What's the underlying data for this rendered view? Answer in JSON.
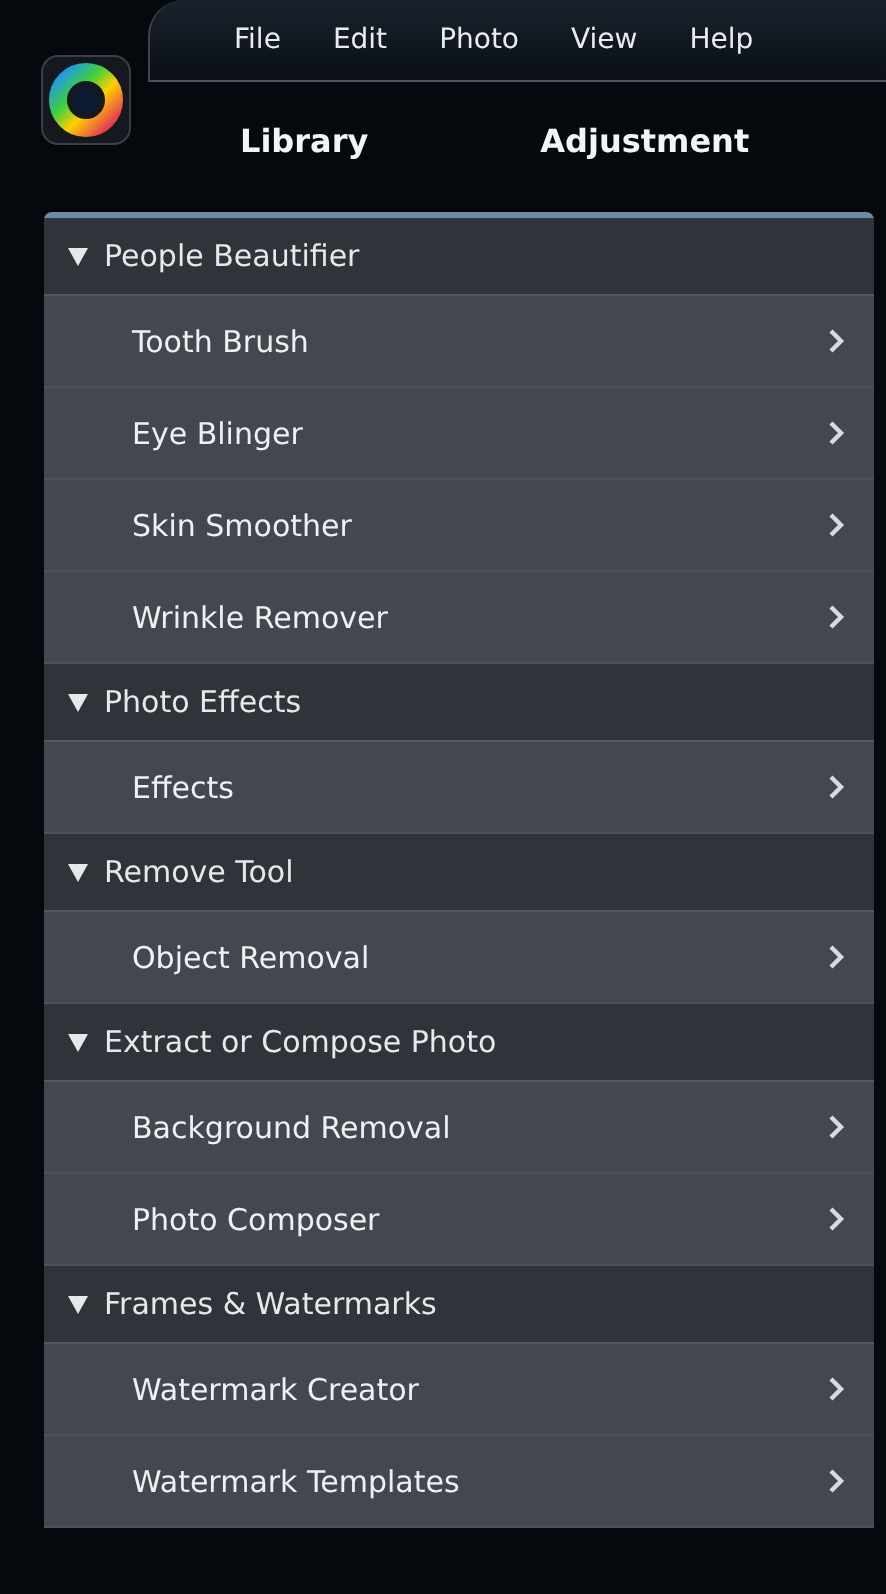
{
  "menu_bar": {
    "items": [
      "File",
      "Edit",
      "Photo",
      "View",
      "Help"
    ]
  },
  "tabs": [
    {
      "label": "Library"
    },
    {
      "label": "Adjustment"
    }
  ],
  "sections": [
    {
      "title": "People Beautifier",
      "expanded": true,
      "items": [
        "Tooth Brush",
        "Eye Blinger",
        "Skin Smoother",
        "Wrinkle Remover"
      ]
    },
    {
      "title": "Photo Effects",
      "expanded": true,
      "items": [
        "Effects"
      ]
    },
    {
      "title": "Remove Tool",
      "expanded": true,
      "items": [
        "Object Removal"
      ]
    },
    {
      "title": "Extract or Compose Photo",
      "expanded": true,
      "items": [
        "Background Removal",
        "Photo Composer"
      ]
    },
    {
      "title": "Frames & Watermarks",
      "expanded": true,
      "items": [
        "Watermark Creator",
        "Watermark Templates"
      ]
    }
  ]
}
